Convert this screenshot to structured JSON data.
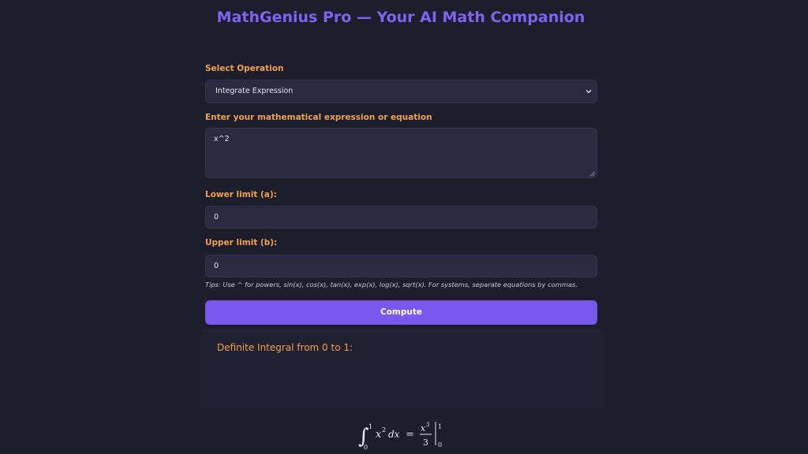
{
  "app": {
    "title": "MathGenius Pro — Your AI Math Companion"
  },
  "form": {
    "operation": {
      "label": "Select Operation",
      "selected": "Integrate Expression"
    },
    "expression": {
      "label": "Enter your mathematical expression or equation",
      "value": "x^2"
    },
    "lower_limit": {
      "label": "Lower limit (a):",
      "value": "0"
    },
    "upper_limit": {
      "label": "Upper limit (b):",
      "value": "0"
    },
    "tips": "Tips: Use ^ for powers, sin(x), cos(x), tan(x), exp(x), log(x), sqrt(x). For systems, separate equations by commas.",
    "compute_label": "Compute"
  },
  "result": {
    "heading": "Definite Integral from 0 to 1:",
    "formula": {
      "integral_sign": "∫",
      "upper": "1",
      "lower": "0",
      "integrand_base": "x",
      "integrand_exp": "2",
      "differential": "dx",
      "equals": "=",
      "numerator_base": "x",
      "numerator_exp": "3",
      "denominator": "3",
      "eval_upper": "1",
      "eval_lower": "0"
    }
  },
  "colors": {
    "background": "#1e1d2b",
    "title": "#7f63f4",
    "label": "#f0a24d",
    "field": "#2a2a40",
    "button": "#7a57ee",
    "result_card": "#202030"
  },
  "icons": {
    "select_chevron": "chevron-down-icon",
    "textarea_grip": "resize-grip-icon"
  }
}
